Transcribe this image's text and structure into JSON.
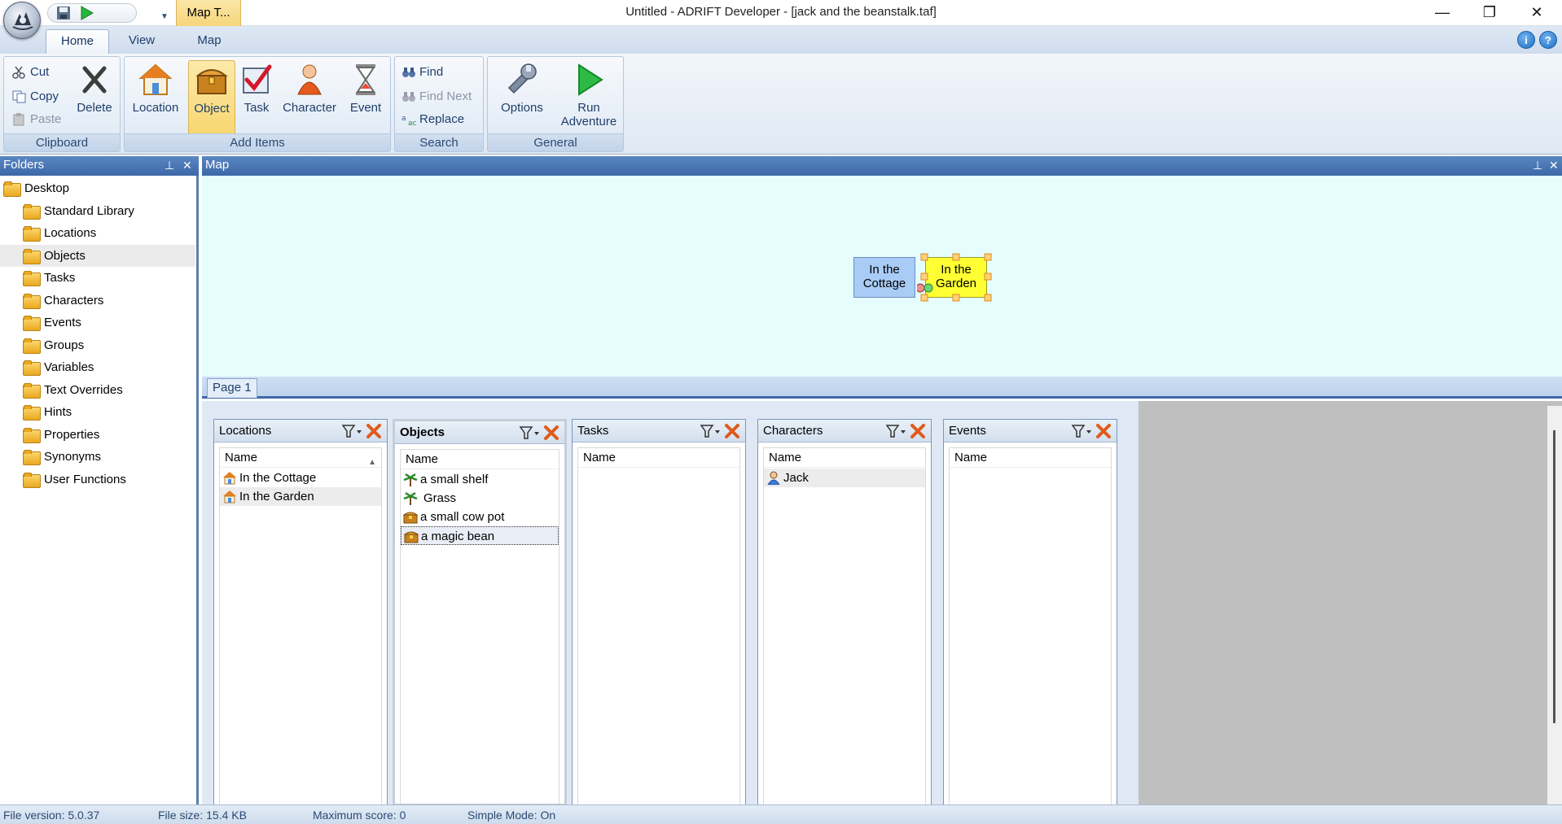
{
  "window": {
    "title": "Untitled - ADRIFT Developer - [jack and the beanstalk.taf]",
    "context_tab": "Map T...",
    "minimize": "—",
    "restore": "❐",
    "close": "✕"
  },
  "ribbon_tabs": [
    "Home",
    "View",
    "Map"
  ],
  "ribbon": {
    "clipboard": {
      "label": "Clipboard",
      "cut": "Cut",
      "copy": "Copy",
      "paste": "Paste",
      "delete": "Delete"
    },
    "add_items": {
      "label": "Add Items",
      "location": "Location",
      "object": "Object",
      "task": "Task",
      "character": "Character",
      "event": "Event"
    },
    "search": {
      "label": "Search",
      "find": "Find",
      "find_next": "Find Next",
      "replace": "Replace"
    },
    "general": {
      "label": "General",
      "options": "Options",
      "run_line1": "Run",
      "run_line2": "Adventure"
    }
  },
  "folders": {
    "title": "Folders",
    "root": "Desktop",
    "items": [
      "Standard Library",
      "Locations",
      "Objects",
      "Tasks",
      "Characters",
      "Events",
      "Groups",
      "Variables",
      "Text Overrides",
      "Hints",
      "Properties",
      "Synonyms",
      "User Functions"
    ],
    "selected": "Objects"
  },
  "map": {
    "title": "Map",
    "nodes": [
      {
        "line1": "In the",
        "line2": "Cottage",
        "color": "#a8ccf5"
      },
      {
        "line1": "In the",
        "line2": "Garden",
        "color": "#ffff33"
      }
    ],
    "page_tab": "Page 1"
  },
  "lists": {
    "column_name": "Name",
    "locations": {
      "title": "Locations",
      "rows": [
        "In the Cottage",
        "In the Garden"
      ]
    },
    "objects": {
      "title": "Objects",
      "rows": [
        "a small shelf",
        "Grass",
        "a small cow pot",
        "a magic bean"
      ]
    },
    "tasks": {
      "title": "Tasks",
      "rows": []
    },
    "characters": {
      "title": "Characters",
      "rows": [
        "Jack"
      ]
    },
    "events": {
      "title": "Events",
      "rows": []
    }
  },
  "status": {
    "file_version": "File version: 5.0.37",
    "file_size": "File size: 15.4 KB",
    "max_score": "Maximum score: 0",
    "simple_mode": "Simple Mode: On"
  }
}
